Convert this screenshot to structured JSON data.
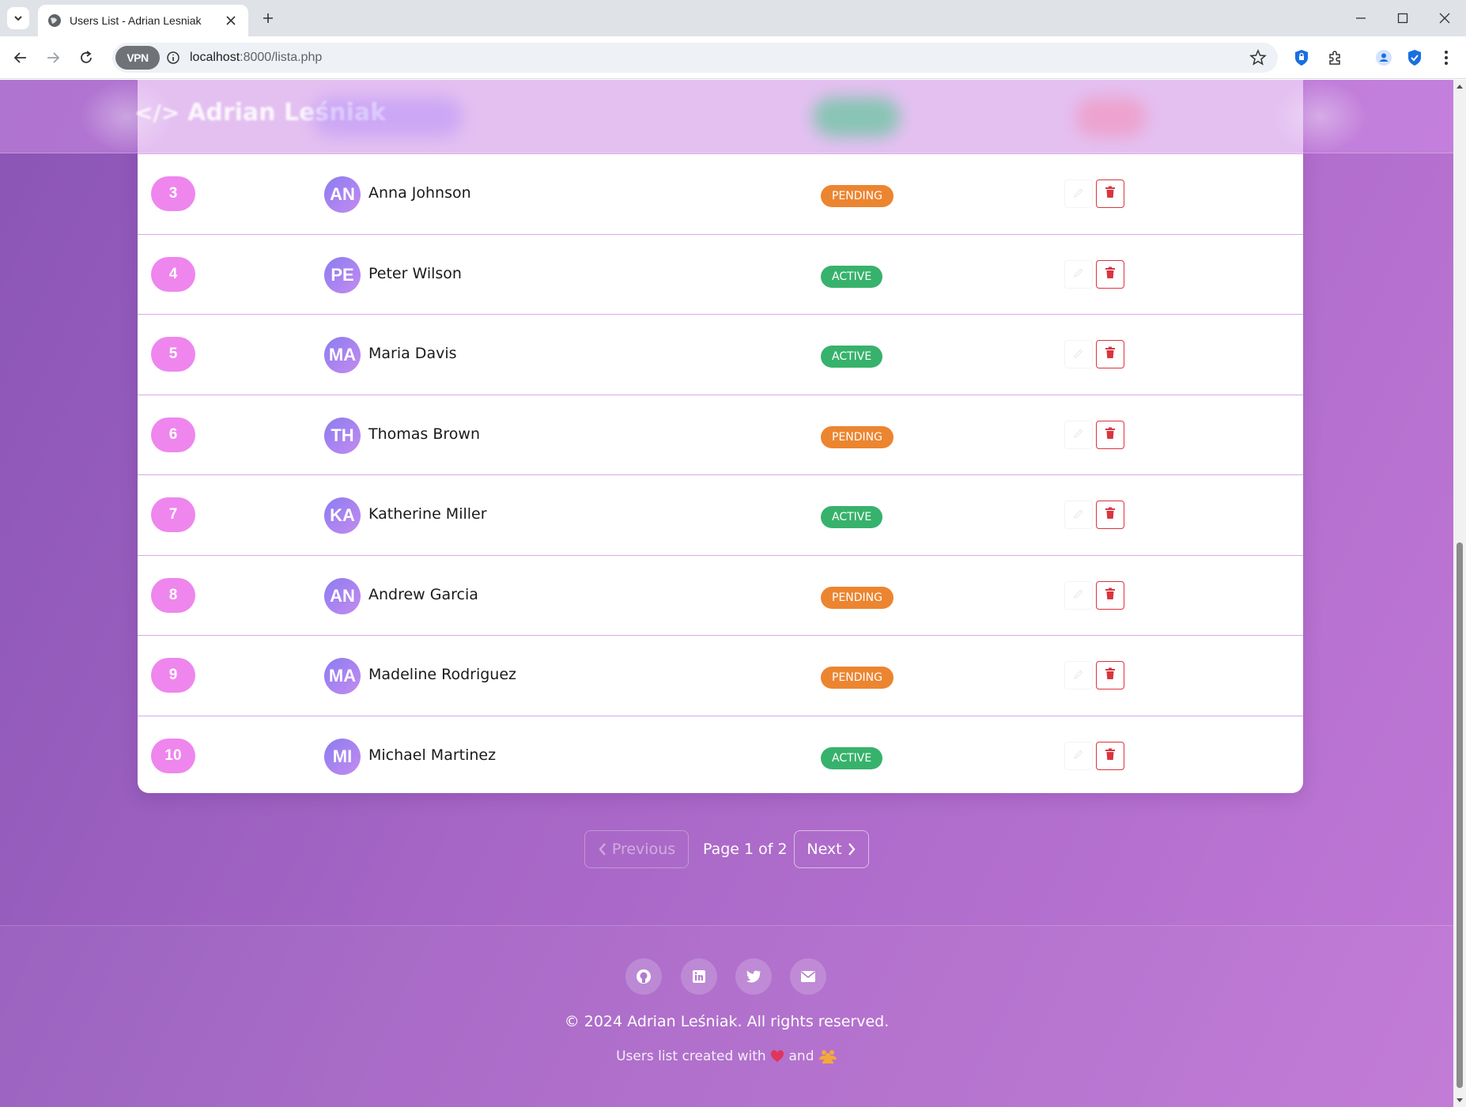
{
  "browser": {
    "tab_title": "Users List - Adrian Lesniak",
    "url_host": "localhost",
    "url_path": ":8000/lista.php",
    "vpn_label": "VPN"
  },
  "header": {
    "brand": "Adrian Leśniak",
    "brand_code": "</>"
  },
  "users": [
    {
      "id": "3",
      "initials": "AN",
      "name": "Anna Johnson",
      "status": "PENDING"
    },
    {
      "id": "4",
      "initials": "PE",
      "name": "Peter Wilson",
      "status": "ACTIVE"
    },
    {
      "id": "5",
      "initials": "MA",
      "name": "Maria Davis",
      "status": "ACTIVE"
    },
    {
      "id": "6",
      "initials": "TH",
      "name": "Thomas Brown",
      "status": "PENDING"
    },
    {
      "id": "7",
      "initials": "KA",
      "name": "Katherine Miller",
      "status": "ACTIVE"
    },
    {
      "id": "8",
      "initials": "AN",
      "name": "Andrew Garcia",
      "status": "PENDING"
    },
    {
      "id": "9",
      "initials": "MA",
      "name": "Madeline Rodriguez",
      "status": "PENDING"
    },
    {
      "id": "10",
      "initials": "MI",
      "name": "Michael Martinez",
      "status": "ACTIVE"
    }
  ],
  "pagination": {
    "previous_label": "Previous",
    "page_info": "Page 1 of 2",
    "next_label": "Next"
  },
  "footer": {
    "social": [
      "github-icon",
      "linkedin-icon",
      "twitter-icon",
      "envelope-icon"
    ],
    "copyright": "© 2024 Adrian Leśniak. All rights reserved.",
    "made_with_prefix": "Users list created with",
    "made_with_and": "and"
  },
  "colors": {
    "pending": "#ec8530",
    "active": "#37b26c",
    "id_pill": "#ee86ee",
    "delete": "#d9353f"
  }
}
